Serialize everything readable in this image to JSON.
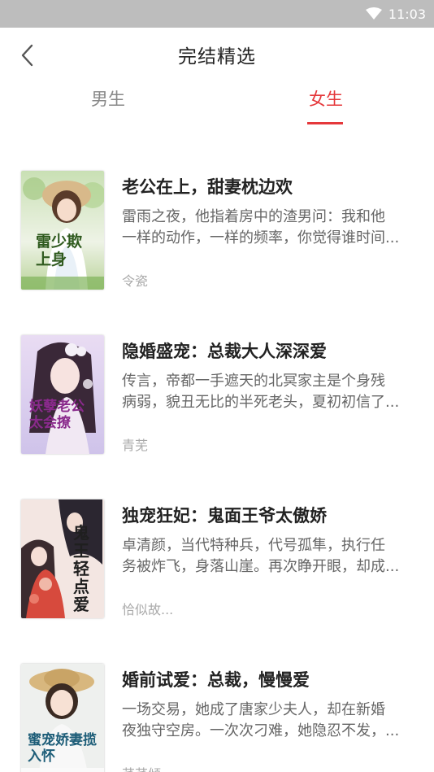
{
  "status_bar": {
    "time": "11:03",
    "wifi_icon": "wifi-icon"
  },
  "header": {
    "title": "完结精选",
    "back_icon": "chevron-left-icon"
  },
  "tabs": [
    {
      "label": "男生",
      "active": false
    },
    {
      "label": "女生",
      "active": true
    }
  ],
  "colors": {
    "accent": "#e5383b",
    "status_bar": "#bdbdbd"
  },
  "books": [
    {
      "title": "老公在上，甜妻枕边欢",
      "description_line1": "雷雨之夜，他指着房中的渣男问：我和他",
      "description_line2": "一样的动作，一样的频率，你觉得谁时间...",
      "author": "令瓷",
      "cover_text": "雷少欺上身"
    },
    {
      "title": "隐婚盛宠：总裁大人深深爱",
      "description_line1": "传言，帝都一手遮天的北冥家主是个身残",
      "description_line2": "病弱，貌丑无比的半死老头，夏初初信了...",
      "author": "青芜",
      "cover_text": "妖孽老公太会撩"
    },
    {
      "title": "独宠狂妃：鬼面王爷太傲娇",
      "description_line1": "卓清颜，当代特种兵，代号孤隼，执行任",
      "description_line2": "务被炸飞，身落山崖。再次睁开眼，却成...",
      "author": "恰似故...",
      "cover_text": "鬼王轻点爱"
    },
    {
      "title": "婚前试爱：总裁，慢慢爱",
      "description_line1": "一场交易，她成了唐家少夫人，却在新婚",
      "description_line2": "夜独守空房。一次次刁难，她隐忍不发，...",
      "author": "芊芊倾",
      "cover_text": "蜜宠娇妻揽入怀"
    }
  ]
}
